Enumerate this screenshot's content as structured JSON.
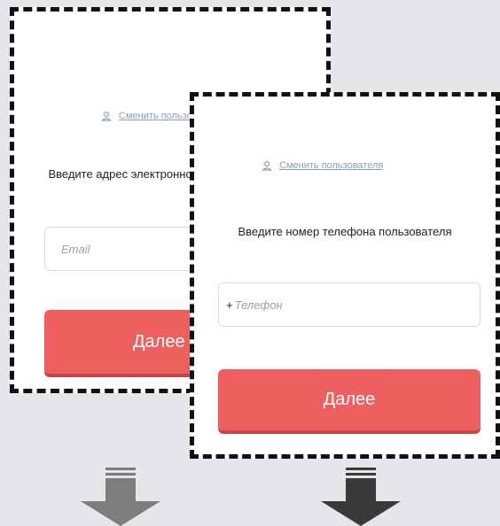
{
  "email_card": {
    "switch_user_label": "Сменить пользователя",
    "prompt": "Введите адрес электронной почты пользователя",
    "email_placeholder": "Email",
    "next_button": "Далее"
  },
  "phone_card": {
    "switch_user_label": "Сменить пользователя",
    "prompt": "Введите номер телефона пользователя",
    "phone_prefix": "+",
    "phone_placeholder": "Телефон",
    "next_button": "Далее"
  },
  "colors": {
    "button": "#ee6060",
    "button_shadow": "#c84545",
    "link": "#8e9cb5",
    "arrow_left": "#7d7d7d",
    "arrow_right": "#3a3a3a"
  },
  "icons": {
    "user": "person-icon",
    "arrow_left": "down-arrow-icon",
    "arrow_right": "down-arrow-icon"
  }
}
